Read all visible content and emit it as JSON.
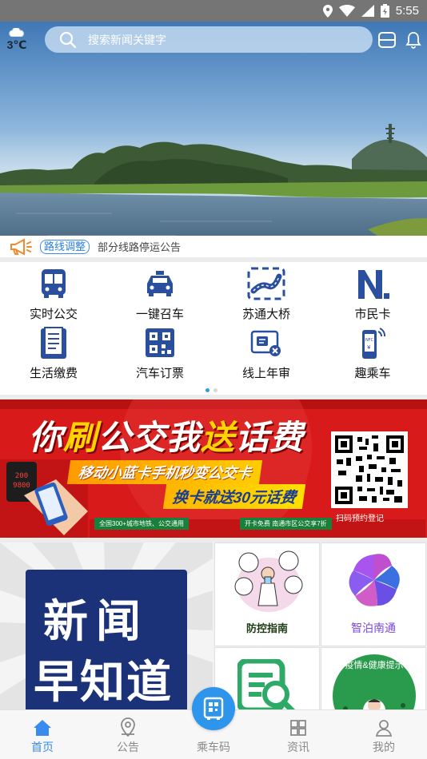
{
  "status_bar": {
    "time": "5:55"
  },
  "header": {
    "weather_temp": "3℃",
    "search_placeholder": "搜索新闻关键字"
  },
  "notice": {
    "tag": "路线调整",
    "text": "部分线路停运公告"
  },
  "services": [
    {
      "label": "实时公交",
      "icon": "bus-icon"
    },
    {
      "label": "一键召车",
      "icon": "taxi-icon"
    },
    {
      "label": "苏通大桥",
      "icon": "bridge-icon"
    },
    {
      "label": "市民卡",
      "icon": "citizen-card-icon"
    },
    {
      "label": "生活缴费",
      "icon": "bill-icon"
    },
    {
      "label": "汽车订票",
      "icon": "ticket-icon"
    },
    {
      "label": "线上年审",
      "icon": "card-review-icon"
    },
    {
      "label": "趣乘车",
      "icon": "nfc-phone-icon"
    }
  ],
  "carousel": {
    "pages": 2,
    "active": 0
  },
  "banner": {
    "title_part1": "你",
    "title_part2": "刷",
    "title_part3": "公交我",
    "title_part4": "送",
    "title_part5": "话费",
    "subtitle1": "移动小蓝卡手机秒变公交卡",
    "subtitle2": "换卡就送30元话费",
    "foot1": "全国300+城市地铁、公交通用",
    "foot2": "开卡免费 南通市区公交享7折",
    "qr_caption": "扫码预约登记"
  },
  "news": {
    "board_line1": "新闻",
    "board_line2": "早知道",
    "tiles": [
      {
        "label": "防控指南"
      },
      {
        "label": "智泊南通"
      },
      {
        "label": ""
      },
      {
        "label": "疫情&健康提示"
      }
    ]
  },
  "tabbar": {
    "items": [
      {
        "label": "首页",
        "active": true
      },
      {
        "label": "公告",
        "active": false
      },
      {
        "label": "乘车码",
        "active": false
      },
      {
        "label": "资讯",
        "active": false
      },
      {
        "label": "我的",
        "active": false
      }
    ]
  },
  "colors": {
    "accent": "#2e95ec",
    "banner_red": "#d91a1a",
    "news_board": "#1b3278"
  }
}
